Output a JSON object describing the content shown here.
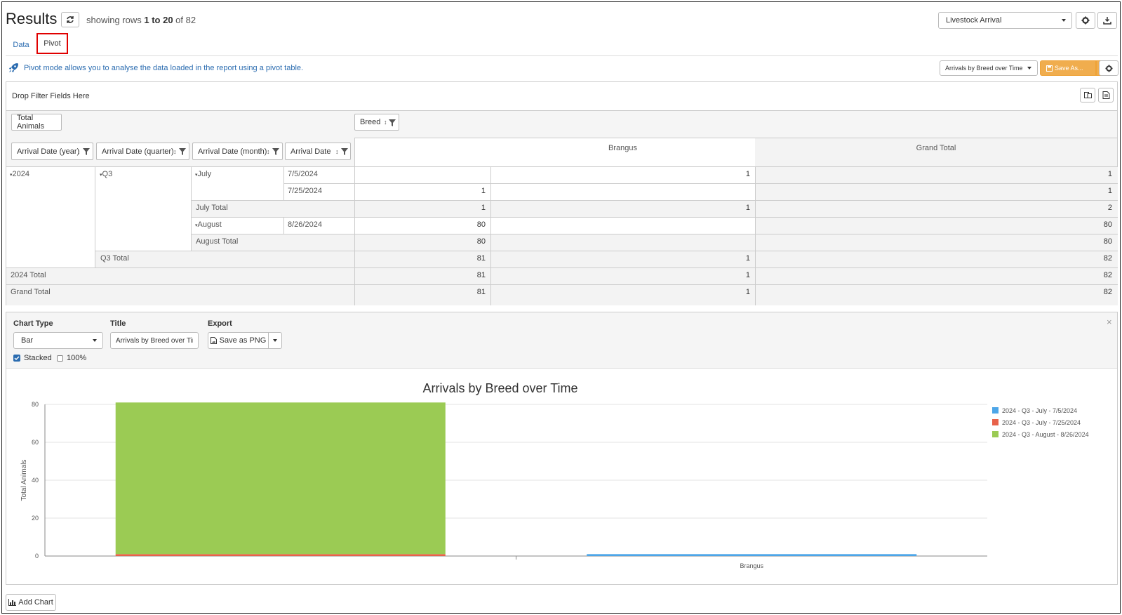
{
  "header": {
    "title": "Results",
    "rows_prefix": "showing rows ",
    "rows_range": "1 to 20",
    "rows_suffix": " of 82",
    "report_select": "Livestock Arrival"
  },
  "tabs": [
    {
      "label": "Data",
      "active": false
    },
    {
      "label": "Pivot",
      "active": true
    }
  ],
  "pivot": {
    "info_text": "Pivot mode allows you to analyse the data loaded in the report using a pivot table.",
    "layout_select": "Arrivals by Breed over Time",
    "save_as_label": "Save As...",
    "filter_drop_text": "Drop Filter Fields Here",
    "value_field": "Total Animals",
    "column_field": "Breed",
    "row_fields": [
      "Arrival Date (year)",
      "Arrival Date (quarter)",
      "Arrival Date (month)",
      "Arrival Date"
    ],
    "column_headers": [
      "",
      "Brangus",
      "Grand Total"
    ],
    "rows": {
      "year": "2024",
      "quarter": "Q3",
      "month_july": "July",
      "month_august": "August",
      "dates": [
        "7/5/2024",
        "7/25/2024",
        "8/26/2024"
      ],
      "july_total": "July Total",
      "august_total": "August Total",
      "q3_total": "Q3 Total",
      "year_total": "2024 Total",
      "grand_total": "Grand Total"
    },
    "values": {
      "r1": [
        "",
        "1",
        "1"
      ],
      "r2": [
        "1",
        "",
        "1"
      ],
      "july_total": [
        "1",
        "1",
        "2"
      ],
      "r3": [
        "80",
        "",
        "80"
      ],
      "august_total": [
        "80",
        "",
        "80"
      ],
      "q3_total": [
        "81",
        "1",
        "82"
      ],
      "year_total": [
        "81",
        "1",
        "82"
      ],
      "grand_total": [
        "81",
        "1",
        "82"
      ]
    }
  },
  "chart_config": {
    "chart_type_label": "Chart Type",
    "chart_type_value": "Bar",
    "title_label": "Title",
    "title_value": "Arrivals by Breed over Time",
    "export_label": "Export",
    "export_button": "Save as PNG",
    "stacked_label": "Stacked",
    "stacked_checked": true,
    "percent_label": "100%",
    "percent_checked": false
  },
  "chart_data": {
    "type": "bar",
    "stacked": true,
    "title": "Arrivals by Breed over Time",
    "ylabel": "Total Animals",
    "xlabel": "",
    "categories": [
      "",
      "Brangus"
    ],
    "ylim": [
      0,
      80
    ],
    "yticks": [
      0,
      20,
      40,
      60,
      80
    ],
    "series": [
      {
        "name": "2024 - Q3 - July - 7/5/2024",
        "color": "#4da6e8",
        "values": [
          0,
          1
        ]
      },
      {
        "name": "2024 - Q3 - July - 7/25/2024",
        "color": "#e8624a",
        "values": [
          1,
          0
        ]
      },
      {
        "name": "2024 - Q3 - August - 8/26/2024",
        "color": "#9bcb54",
        "values": [
          80,
          0
        ]
      }
    ],
    "legend_position": "right",
    "grid": true
  },
  "footer": {
    "add_chart_label": "Add Chart"
  },
  "colors": {
    "accent": "#2b6cb0",
    "save_button": "#f0ad4e",
    "tab_highlight": "#e00000"
  }
}
